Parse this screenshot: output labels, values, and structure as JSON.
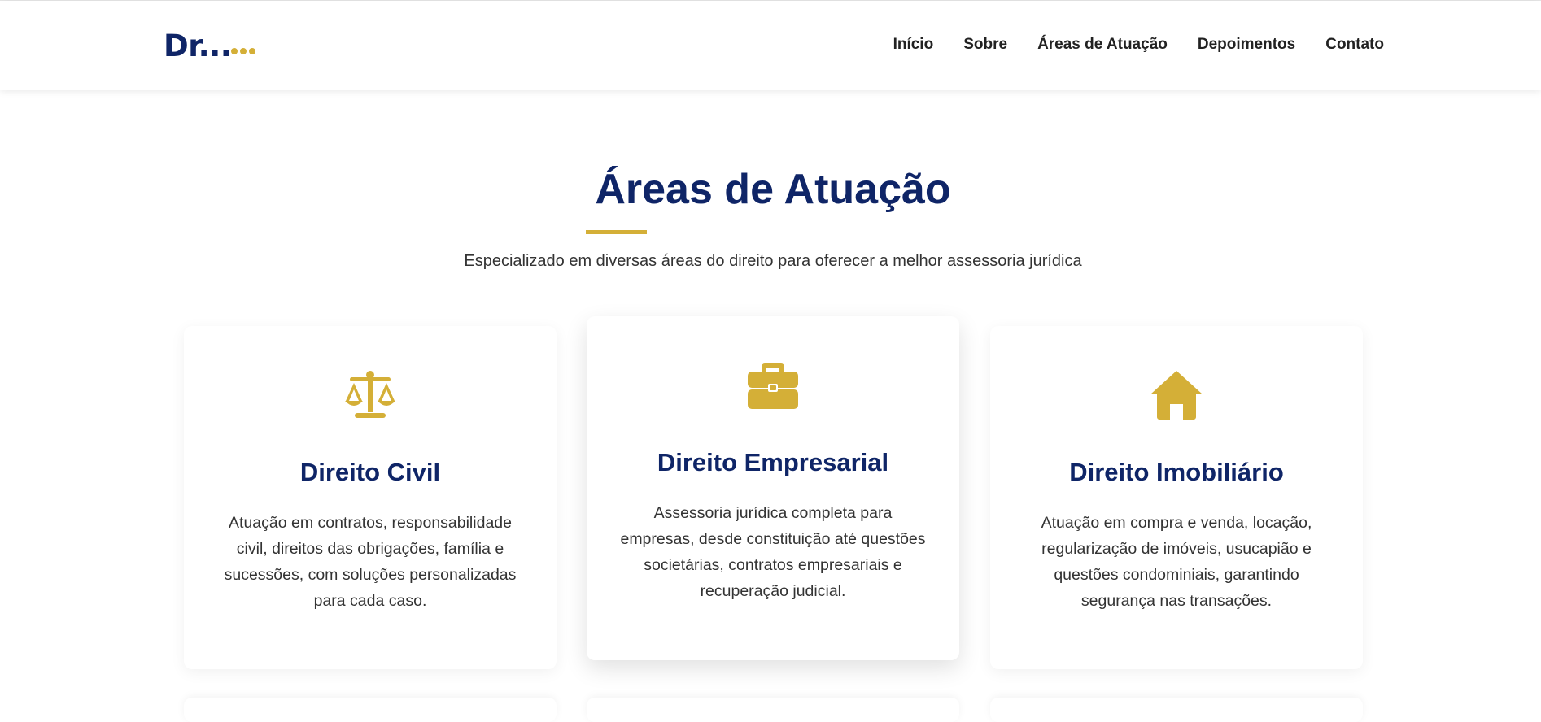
{
  "header": {
    "logo": "Dr...",
    "logo_dots_icon": "ellipsis-dots",
    "nav": [
      {
        "label": "Início"
      },
      {
        "label": "Sobre"
      },
      {
        "label": "Áreas de Atuação"
      },
      {
        "label": "Depoimentos"
      },
      {
        "label": "Contato"
      }
    ]
  },
  "section": {
    "title": "Áreas de Atuação",
    "subtitle": "Especializado em diversas áreas do direito para oferecer a melhor assessoria jurídica"
  },
  "cards": [
    {
      "icon": "scales-icon",
      "title": "Direito Civil",
      "text": "Atuação em contratos, responsabilidade civil, direitos das obrigações, família e sucessões, com soluções personalizadas para cada caso."
    },
    {
      "icon": "briefcase-icon",
      "title": "Direito Empresarial",
      "text": "Assessoria jurídica completa para empresas, desde constituição até questões societárias, contratos empresariais e recuperação judicial."
    },
    {
      "icon": "home-icon",
      "title": "Direito Imobiliário",
      "text": "Atuação em compra e venda, locação, regularização de imóveis, usucapião e questões condominiais, garantindo segurança nas transações."
    }
  ],
  "colors": {
    "primary": "#0f2567",
    "accent": "#d4af37",
    "text": "#333333"
  }
}
